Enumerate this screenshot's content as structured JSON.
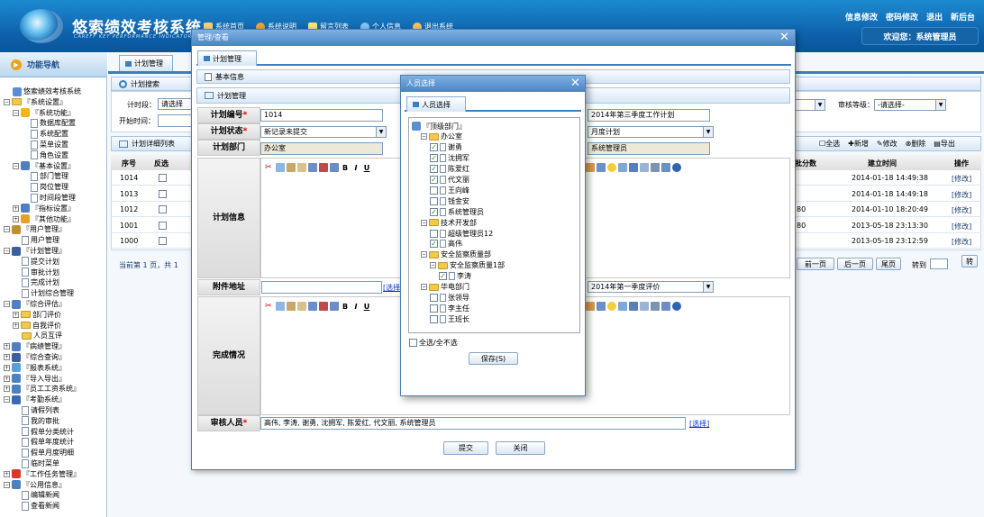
{
  "header": {
    "app_title": "悠索绩效考核系统",
    "app_subtitle": "CAREFF KEY PERFORMANCE INDICATOR",
    "nav": [
      "系统首页",
      "系统说明",
      "留言列表",
      "个人信息",
      "退出系统"
    ],
    "top_links": [
      "信息修改",
      "密码修改",
      "退出",
      "新后台"
    ],
    "welcome": "欢迎您：系统管理员"
  },
  "sidebar": {
    "title": "功能导航",
    "items": [
      {
        "label": "悠索绩效考核系统",
        "level": 0,
        "type": "root"
      },
      {
        "label": "『系统设置』",
        "level": 0,
        "type": "folder",
        "exp": "-"
      },
      {
        "label": "『系统功能』",
        "level": 1,
        "type": "star",
        "exp": "-"
      },
      {
        "label": "数据库配置",
        "level": 2,
        "type": "page"
      },
      {
        "label": "系统配置",
        "level": 2,
        "type": "page"
      },
      {
        "label": "菜单设置",
        "level": 2,
        "type": "page"
      },
      {
        "label": "角色设置",
        "level": 2,
        "type": "page"
      },
      {
        "label": "『基本设置』",
        "level": 1,
        "type": "grid",
        "exp": "-"
      },
      {
        "label": "部门管理",
        "level": 2,
        "type": "page"
      },
      {
        "label": "岗位管理",
        "level": 2,
        "type": "page"
      },
      {
        "label": "时间段管理",
        "level": 2,
        "type": "page"
      },
      {
        "label": "『指标设置』",
        "level": 1,
        "type": "grid",
        "exp": "+"
      },
      {
        "label": "『其他功能』",
        "level": 1,
        "type": "gear",
        "exp": "+"
      },
      {
        "label": "『用户管理』",
        "level": 0,
        "type": "user",
        "exp": "-"
      },
      {
        "label": "用户管理",
        "level": 1,
        "type": "page"
      },
      {
        "label": "『计划管理』",
        "level": 0,
        "type": "glass",
        "exp": "-"
      },
      {
        "label": "提交计划",
        "level": 1,
        "type": "page"
      },
      {
        "label": "审批计划",
        "level": 1,
        "type": "page"
      },
      {
        "label": "完成计划",
        "level": 1,
        "type": "page"
      },
      {
        "label": "计划综合管理",
        "level": 1,
        "type": "page"
      },
      {
        "label": "『综合评估』",
        "level": 0,
        "type": "grid",
        "exp": "-"
      },
      {
        "label": "部门评价",
        "level": 1,
        "type": "folder",
        "exp": "+"
      },
      {
        "label": "自我评价",
        "level": 1,
        "type": "folder",
        "exp": "+"
      },
      {
        "label": "人员互评",
        "level": 1,
        "type": "folder"
      },
      {
        "label": "『病绩管理』",
        "level": 0,
        "type": "grid",
        "exp": "+"
      },
      {
        "label": "『综合查询』",
        "level": 0,
        "type": "glass",
        "exp": "+"
      },
      {
        "label": "『报表系统』",
        "level": 0,
        "type": "chart",
        "exp": "+"
      },
      {
        "label": "『导入导出』",
        "level": 0,
        "type": "grid",
        "exp": "+"
      },
      {
        "label": "『员工工资系统』",
        "level": 0,
        "type": "grid",
        "exp": "+"
      },
      {
        "label": "『考勤系统』",
        "level": 0,
        "type": "book",
        "exp": "-"
      },
      {
        "label": "请假列表",
        "level": 1,
        "type": "page"
      },
      {
        "label": "我的审批",
        "level": 1,
        "type": "page"
      },
      {
        "label": "假单分类统计",
        "level": 1,
        "type": "page"
      },
      {
        "label": "假单年度统计",
        "level": 1,
        "type": "page"
      },
      {
        "label": "假单月度明细",
        "level": 1,
        "type": "page"
      },
      {
        "label": "临时菜单",
        "level": 1,
        "type": "page"
      },
      {
        "label": "『工作任务管理』",
        "level": 0,
        "type": "flag",
        "exp": "+"
      },
      {
        "label": "『公用信息』",
        "level": 0,
        "type": "grid",
        "exp": "-"
      },
      {
        "label": "编辑新闻",
        "level": 1,
        "type": "page"
      },
      {
        "label": "查看新闻",
        "level": 1,
        "type": "page"
      }
    ]
  },
  "main": {
    "tab": "计划管理",
    "search_title": "计划搜索",
    "time_label": "计时段：",
    "time_select": "请选择",
    "start_label": "开始时间：",
    "grade_label": "审核等级：",
    "grade_select": "-请选择-",
    "list_title": "计划详细列表",
    "actions": [
      "全选",
      "新增",
      "修改",
      "删除",
      "导出"
    ],
    "columns": [
      "序号",
      "反选"
    ],
    "right_columns": [
      "批分数",
      "建立时间",
      "操作"
    ],
    "rows": [
      {
        "id": "1014",
        "score": "",
        "time": "2014-01-18 14:49:38",
        "op": "[修改]"
      },
      {
        "id": "1013",
        "score": "",
        "time": "2014-01-18 14:49:18",
        "op": "[修改]"
      },
      {
        "id": "1012",
        "score": "80",
        "time": "2014-01-10 18:20:49",
        "op": "[修改]"
      },
      {
        "id": "1001",
        "score": "80",
        "time": "2013-05-18 23:13:30",
        "op": "[修改]"
      },
      {
        "id": "1000",
        "score": "",
        "time": "2013-05-18 23:12:59",
        "op": "[修改]"
      }
    ],
    "pager_left": "当前第 1 页，共 1",
    "pager_btns": [
      "前一页",
      "后一页",
      "尾页"
    ],
    "goto_label": "转到",
    "goto_btn": "转"
  },
  "dialog": {
    "title": "管理/查看",
    "tab1": "计划管理",
    "tab2": "基本信息",
    "section": "计划管理",
    "fields": {
      "code_label": "计划编号",
      "code_value": "1014",
      "status_label": "计划状态",
      "status_value": "新记录未提交",
      "dept_label": "计划部门",
      "dept_value": "办公室",
      "name_value": "2014年第三季度工作计划",
      "type_value": "月度计划",
      "creator_value": "系统管理员",
      "info_label": "计划信息",
      "attach_label": "附件地址",
      "select_link": "[选择]",
      "period_value": "2014年第一季度评价",
      "done_label": "完成情况",
      "reviewer_label": "审核人员",
      "reviewer_value": "高伟, 李涛, 谢勇, 沈拥军, 陈爱红, 代文丽, 系统管理员"
    },
    "buttons": {
      "submit": "提交",
      "close": "关闭"
    }
  },
  "picker": {
    "title": "人员选择",
    "tab": "人员选择",
    "save": "保存(S)",
    "select_all": "全选/全不选",
    "tree": [
      {
        "label": "『顶级部门』",
        "level": 0,
        "kind": "root"
      },
      {
        "label": "办公室",
        "level": 1,
        "kind": "folder"
      },
      {
        "label": "谢勇",
        "level": 2,
        "kind": "person",
        "checked": true
      },
      {
        "label": "沈拥军",
        "level": 2,
        "kind": "person",
        "checked": true
      },
      {
        "label": "陈爱红",
        "level": 2,
        "kind": "person",
        "checked": true
      },
      {
        "label": "代文丽",
        "level": 2,
        "kind": "person",
        "checked": true
      },
      {
        "label": "王向峰",
        "level": 2,
        "kind": "person",
        "checked": false
      },
      {
        "label": "钱金安",
        "level": 2,
        "kind": "person",
        "checked": false
      },
      {
        "label": "系统管理员",
        "level": 2,
        "kind": "person",
        "checked": true
      },
      {
        "label": "技术开发部",
        "level": 1,
        "kind": "folder"
      },
      {
        "label": "超级管理员12",
        "level": 2,
        "kind": "person",
        "checked": false
      },
      {
        "label": "高伟",
        "level": 2,
        "kind": "person",
        "checked": true
      },
      {
        "label": "安全监察质量部",
        "level": 1,
        "kind": "folder"
      },
      {
        "label": "安全监察质量1部",
        "level": 2,
        "kind": "folder"
      },
      {
        "label": "李涛",
        "level": 3,
        "kind": "person",
        "checked": true
      },
      {
        "label": "华电部门",
        "level": 1,
        "kind": "folder"
      },
      {
        "label": "张领导",
        "level": 2,
        "kind": "person",
        "checked": false
      },
      {
        "label": "李主任",
        "level": 2,
        "kind": "person",
        "checked": false
      },
      {
        "label": "王班长",
        "level": 2,
        "kind": "person",
        "checked": false
      }
    ]
  },
  "colors": {
    "header_bg": "#0c5fa8",
    "accent": "#3a7fc0",
    "required": "#d40000",
    "link": "#0033cc"
  }
}
